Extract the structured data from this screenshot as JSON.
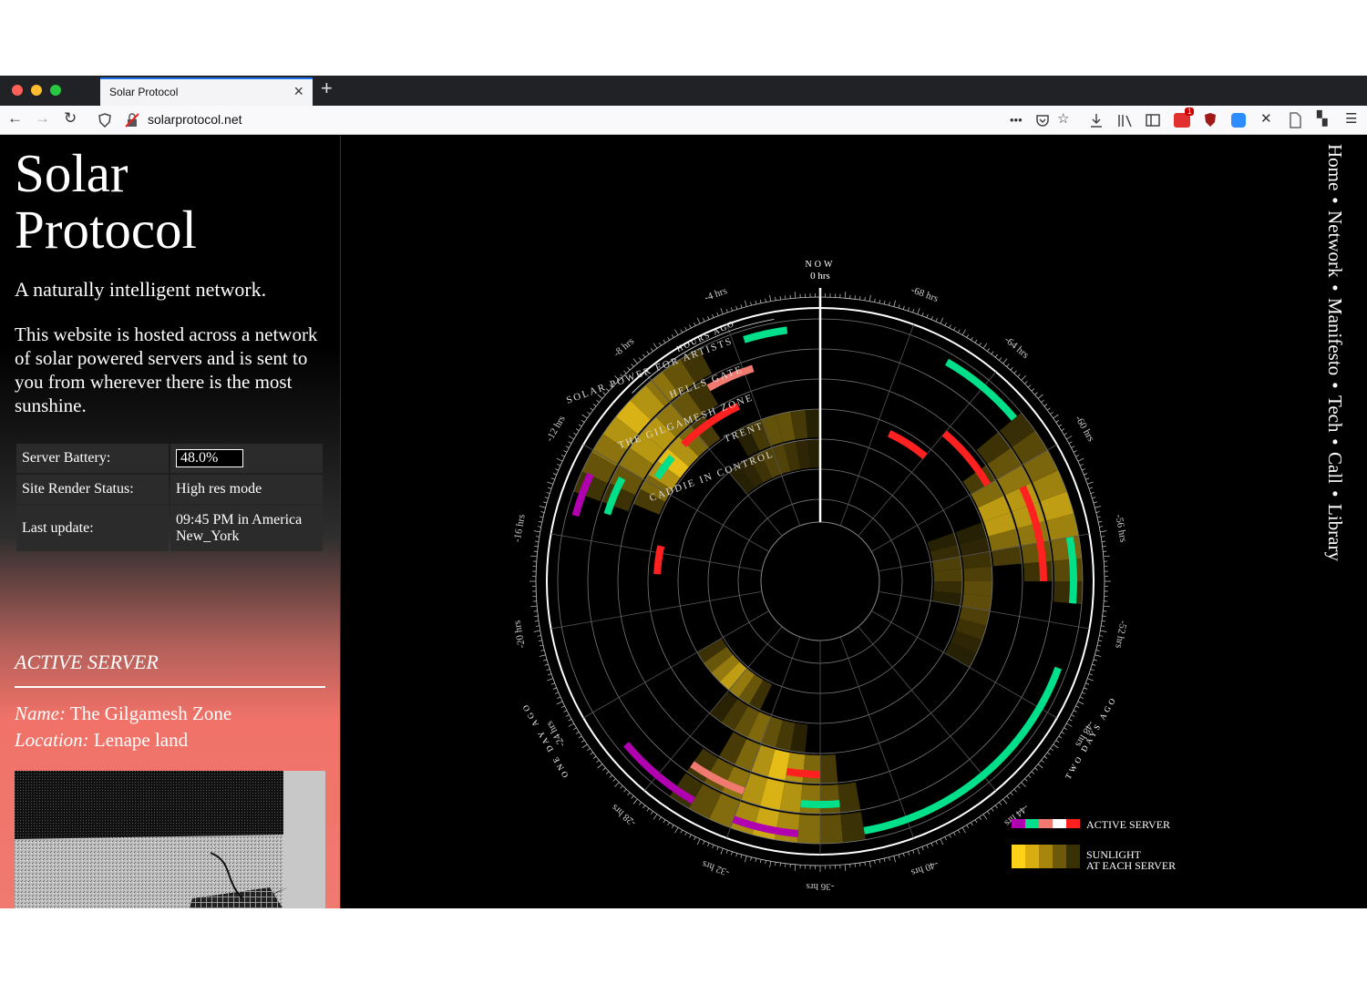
{
  "browser": {
    "tab_title": "Solar Protocol",
    "url": "solarprotocol.net",
    "menu_dots": "•••",
    "notification_count": "1"
  },
  "site": {
    "title_line1": "Solar",
    "title_line2": "Protocol",
    "tagline": "A naturally intelligent network.",
    "description": "This website is hosted across a network of solar powered servers and is sent to you from wherever there is the most sunshine."
  },
  "status": {
    "battery_label": "Server Battery:",
    "battery_value": "48.0%",
    "render_label": "Site Render Status:",
    "render_value": "High res mode",
    "update_label": "Last update:",
    "update_value": "09:45 PM in America New_York"
  },
  "active_server": {
    "heading": "ACTIVE SERVER",
    "name_label": "Name:",
    "name_value": "The Gilgamesh Zone",
    "location_label": "Location:",
    "location_value": "Lenape land"
  },
  "nav": {
    "items": [
      "Home",
      "Network",
      "Manifesto",
      "Tech",
      "Call",
      "Library"
    ],
    "separator": "•"
  },
  "chart_data": {
    "type": "radial-timeline",
    "top_label": "NOW",
    "top_hours": "0 hrs",
    "ring_label_hours_ago": "HOURS AGO",
    "label_one_day_ago": "ONE DAY AGO",
    "label_two_days_ago": "TWO DAYS AGO",
    "servers": [
      "SOLAR POWER FOR ARTISTS",
      "HELLS GATE",
      "THE GILGAMESH ZONE",
      "TRENT",
      "CADDIE IN CONTROL"
    ],
    "tick_labels": [
      {
        "hours": -4,
        "text": "-4 hrs"
      },
      {
        "hours": -8,
        "text": "-8 hrs"
      },
      {
        "hours": -12,
        "text": "-12 hrs"
      },
      {
        "hours": -16,
        "text": "-16 hrs"
      },
      {
        "hours": -20,
        "text": "-20 hrs"
      },
      {
        "hours": -24,
        "text": "-24 hrs"
      },
      {
        "hours": -28,
        "text": "-28 hrs"
      },
      {
        "hours": -32,
        "text": "-32 hrs"
      },
      {
        "hours": -36,
        "text": "-36 hrs"
      },
      {
        "hours": -40,
        "text": "-40 hrs"
      },
      {
        "hours": -44,
        "text": "-44 hrs"
      },
      {
        "hours": -48,
        "text": "-48 hrs"
      },
      {
        "hours": -52,
        "text": "-52 hrs"
      },
      {
        "hours": -56,
        "text": "-56 hrs"
      },
      {
        "hours": -60,
        "text": "-60 hrs"
      },
      {
        "hours": -64,
        "text": "-64 hrs"
      },
      {
        "hours": -68,
        "text": "-68 hrs"
      }
    ],
    "sunlight": [
      {
        "ring": 0,
        "start": 5.5,
        "end": 14,
        "level": 0.85
      },
      {
        "ring": 1,
        "start": 6,
        "end": 14,
        "level": 0.8
      },
      {
        "ring": 2,
        "start": 7,
        "end": 13.5,
        "level": 0.9
      },
      {
        "ring": 3,
        "start": 0,
        "end": 6,
        "level": 0.45
      },
      {
        "ring": 4,
        "start": 0,
        "end": 8,
        "level": 0.35
      },
      {
        "ring": 0,
        "start": 29,
        "end": 38,
        "level": 0.8
      },
      {
        "ring": 1,
        "start": 29,
        "end": 38,
        "level": 0.85
      },
      {
        "ring": 2,
        "start": 30,
        "end": 37,
        "level": 0.9
      },
      {
        "ring": 3,
        "start": 28,
        "end": 35,
        "level": 0.5
      },
      {
        "ring": 4,
        "start": 24,
        "end": 31,
        "level": 0.75
      },
      {
        "ring": 0,
        "start": 53,
        "end": 62,
        "level": 0.75
      },
      {
        "ring": 1,
        "start": 54,
        "end": 62,
        "level": 0.8
      },
      {
        "ring": 2,
        "start": 55,
        "end": 61,
        "level": 0.85
      },
      {
        "ring": 3,
        "start": 48,
        "end": 58,
        "level": 0.4
      },
      {
        "ring": 4,
        "start": 52,
        "end": 58,
        "level": 0.35
      }
    ],
    "active_segments": [
      {
        "ring": 0,
        "start": 1.5,
        "end": 3.5,
        "color": "#00e08a"
      },
      {
        "ring": 1,
        "start": 3.5,
        "end": 6,
        "color": "#f07a70"
      },
      {
        "ring": 2,
        "start": 5,
        "end": 9,
        "color": "#ff2020"
      },
      {
        "ring": 2,
        "start": 10,
        "end": 11.5,
        "color": "#00e08a"
      },
      {
        "ring": 1,
        "start": 12.5,
        "end": 14.5,
        "color": "#00e08a"
      },
      {
        "ring": 0,
        "start": 13,
        "end": 15,
        "color": "#b000b0"
      },
      {
        "ring": 3,
        "start": 15.5,
        "end": 17.5,
        "color": "#ff2020"
      },
      {
        "ring": 0,
        "start": 26,
        "end": 30,
        "color": "#b000b0"
      },
      {
        "ring": 1,
        "start": 29,
        "end": 32,
        "color": "#f07a70"
      },
      {
        "ring": 0,
        "start": 32,
        "end": 35,
        "color": "#b000b0"
      },
      {
        "ring": 2,
        "start": 34,
        "end": 36,
        "color": "#ff2020"
      },
      {
        "ring": 1,
        "start": 35,
        "end": 37,
        "color": "#00e08a"
      },
      {
        "ring": 0,
        "start": 38,
        "end": 50,
        "color": "#00e08a"
      },
      {
        "ring": 0,
        "start": 53,
        "end": 56,
        "color": "#00e08a"
      },
      {
        "ring": 1,
        "start": 54,
        "end": 59,
        "color": "#ff2020"
      },
      {
        "ring": 2,
        "start": 60,
        "end": 64,
        "color": "#ff2020"
      },
      {
        "ring": 0,
        "start": 62,
        "end": 66,
        "color": "#00e08a"
      },
      {
        "ring": 3,
        "start": 64,
        "end": 67,
        "color": "#ff2020"
      }
    ]
  },
  "legend": {
    "active_label": "ACTIVE SERVER",
    "active_colors": [
      "#b000b0",
      "#00e08a",
      "#f07a70",
      "#ffffff",
      "#ff2020"
    ],
    "sunlight_label1": "SUNLIGHT",
    "sunlight_label2": "AT EACH SERVER",
    "sunlight_colors": [
      "#ffd21a",
      "#d9ac10",
      "#a8850c",
      "#6e580a",
      "#3a3006"
    ]
  }
}
